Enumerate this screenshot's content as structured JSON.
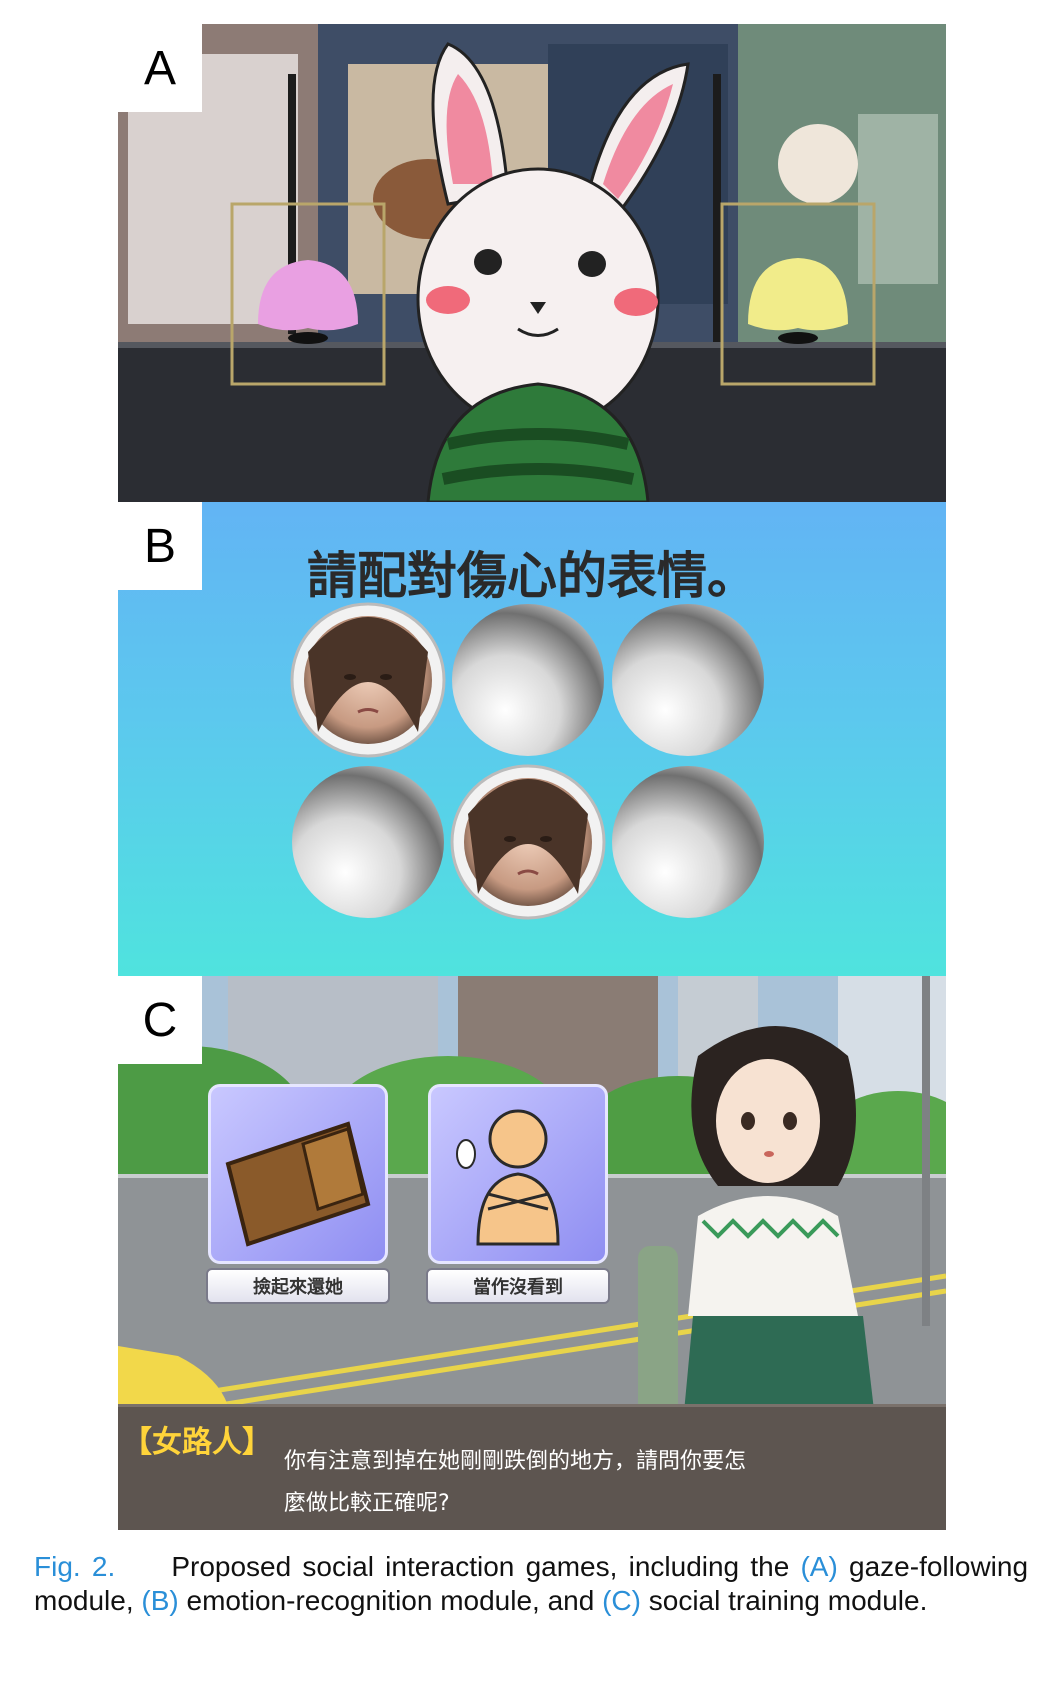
{
  "panels": {
    "a": {
      "label": "A"
    },
    "b": {
      "label": "B",
      "prompt": "請配對傷心的表情。"
    },
    "c": {
      "label": "C",
      "choices": [
        "撿起來還她",
        "當作沒看到"
      ],
      "dialog_speaker": "【女路人】",
      "dialog_lines": [
        "你有注意到掉在她剛剛跌倒的地方，請問你要怎",
        "麼做比較正確呢?"
      ]
    }
  },
  "caption": {
    "fig": "Fig. 2.",
    "text_1": "Proposed social interaction games, including the",
    "ref_a": "(A)",
    "text_2": "gaze-following module,",
    "ref_b": "(B)",
    "text_3": "emotion-recognition module, and",
    "ref_c": "(C)",
    "text_4": "social training module."
  },
  "colors": {
    "accent_blue": "#2a8fd8",
    "dialog_speaker": "#ffd43a"
  }
}
